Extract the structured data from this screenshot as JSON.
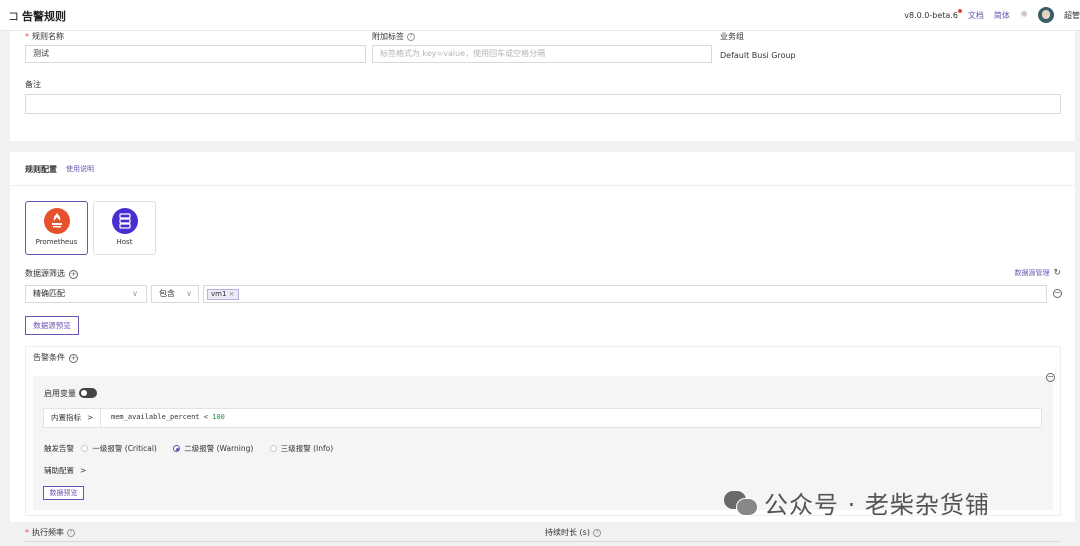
{
  "header": {
    "back_icon": "コ",
    "title": "告警规则",
    "version": "v8.0.0-beta.6",
    "docs": "文档",
    "lang": "简体",
    "user": "超管"
  },
  "basic": {
    "rule_name_label": "规则名称",
    "rule_name_value": "测试",
    "append_tags_label": "附加标签",
    "append_tags_placeholder": "标签格式为 key=value，使用回车或空格分隔",
    "busi_group_label": "业务组",
    "busi_group_value": "Default Busi Group",
    "note_label": "备注",
    "note_value": ""
  },
  "rule_config": {
    "title": "规则配置",
    "help_link": "使用说明",
    "datasource_types": [
      {
        "name": "Prometheus",
        "selected": true,
        "color": "#e6522c"
      },
      {
        "name": "Host",
        "selected": false,
        "color": "#4b2ed1"
      }
    ],
    "ds_filter_label": "数据源筛选",
    "ds_manage_link": "数据源管理",
    "match_type": "精确匹配",
    "operator": "包含",
    "selected_tag": "vm1",
    "ds_preview_btn": "数据源预览"
  },
  "alert_condition": {
    "title": "告警条件",
    "enable_var_label": "启用变量",
    "builtin_metric_label": "内置指标",
    "expression_metric": "mem_available_percent",
    "expression_op": "<",
    "expression_value": "100",
    "trigger_label": "触发告警",
    "levels": [
      {
        "label": "一级报警 (Critical)",
        "checked": false
      },
      {
        "label": "二级报警 (Warning)",
        "checked": true
      },
      {
        "label": "三级报警 (Info)",
        "checked": false
      }
    ],
    "aux_config_label": "辅助配置",
    "data_preview_btn": "数据预览"
  },
  "bottom": {
    "exec_freq_label": "执行频率",
    "duration_label": "持续时长 (s)"
  },
  "watermark": {
    "text": "公众号 · 老柴杂货铺"
  },
  "colors": {
    "accent": "#6c53b1",
    "required": "#e8463c"
  }
}
